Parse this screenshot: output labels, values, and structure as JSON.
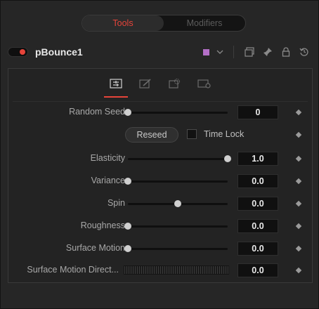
{
  "tabs": {
    "tools": "Tools",
    "modifiers": "Modifiers"
  },
  "header": {
    "tool_name": "pBounce1",
    "color_accent": "#b46fc7",
    "enabled_color": "#e6443a"
  },
  "inspector_tabs": [
    "controls-icon",
    "style-icon",
    "image-icon",
    "settings-icon"
  ],
  "params": {
    "random_seed": {
      "label": "Random Seed",
      "value": "0",
      "fraction": 0
    },
    "reseed": {
      "label": "Reseed"
    },
    "time_lock": {
      "label": "Time Lock",
      "checked": false
    },
    "elasticity": {
      "label": "Elasticity",
      "value": "1.0",
      "fraction": 1.0
    },
    "variance": {
      "label": "Variance",
      "value": "0.0",
      "fraction": 0
    },
    "spin": {
      "label": "Spin",
      "value": "0.0",
      "fraction": 0.5
    },
    "roughness": {
      "label": "Roughness",
      "value": "0.0",
      "fraction": 0
    },
    "surface_motion": {
      "label": "Surface Motion",
      "value": "0.0",
      "fraction": 0
    },
    "surface_motion_direction": {
      "label": "Surface Motion Direct...",
      "value": "0.0"
    }
  }
}
